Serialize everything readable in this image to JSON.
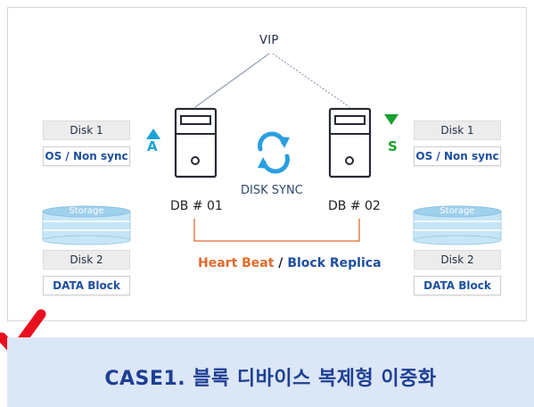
{
  "diagram": {
    "vip_label": "VIP",
    "left_node": {
      "role_letter": "A",
      "name": "DB # 01",
      "disk1": "Disk 1",
      "os_sync": "OS / Non sync",
      "storage": "Storage",
      "disk2": "Disk 2",
      "data_block": "DATA Block",
      "indicator_color": "#1ba3d9"
    },
    "right_node": {
      "role_letter": "S",
      "name": "DB # 02",
      "disk1": "Disk 1",
      "os_sync": "OS / Non sync",
      "storage": "Storage",
      "disk2": "Disk 2",
      "data_block": "DATA Block",
      "indicator_color": "#1aa02e"
    },
    "sync_label": "DISK SYNC",
    "link_label": {
      "heartbeat": "Heart Beat",
      "separator": " / ",
      "replica": "Block Replica"
    },
    "colors": {
      "heartbeat_line": "#e06a2c",
      "sync_icon": "#2a9ee0",
      "checkmark": "#e8101e",
      "banner_bg": "#dbe6f6",
      "banner_text": "#1e3f93"
    }
  },
  "banner": {
    "title": "CASE1. 블록 디바이스 복제형 이중화"
  }
}
